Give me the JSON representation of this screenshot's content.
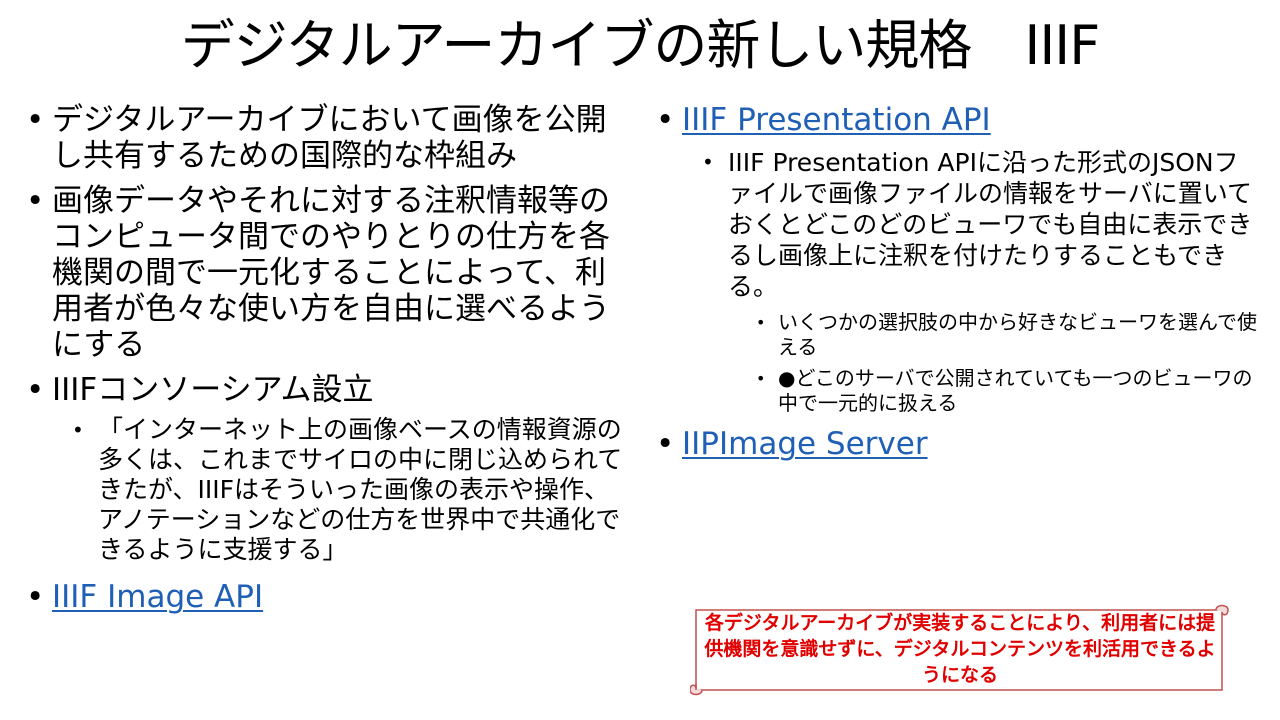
{
  "slide": {
    "title": "デジタルアーカイブの新しい規格　IIIF",
    "left": {
      "item1": "デジタルアーカイブにおいて画像を公開し共有するための国際的な枠組み",
      "item2": "画像データやそれに対する注釈情報等のコンピュータ間でのやりとりの仕方を各機関の間で一元化することによって、利用者が色々な使い方を自由に選べるようにする",
      "item3": "IIIFコンソーシアム設立",
      "item3_sub": "「インターネット上の画像ベースの情報資源の多くは、これまでサイロの中に閉じ込められてきたが、IIIFはそういった画像の表示や操作、アノテーションなどの仕方を世界中で共通化できるように支援する」",
      "item4_link": "IIIF Image API"
    },
    "right": {
      "item1_link": "IIIF Presentation API",
      "item1_sub": "IIIF Presentation APIに沿った形式のJSONファイルで画像ファイルの情報をサーバに置いておくとどこのどのビューワでも自由に表示できるし画像上に注釈を付けたりすることもできる。",
      "item1_sub_a": "いくつかの選択肢の中から好きなビューワを選んで使える",
      "item1_sub_b": "●どこのサーバで公開されていても一つのビューワの中で一元的に扱える",
      "item2_link": "IIPImage Server"
    },
    "callout": "各デジタルアーカイブが実装することにより、利用者には提供機関を意識せずに、デジタルコンテンツを利活用できるようになる",
    "colors": {
      "link": "#1f5fb5",
      "callout_text": "#e00000",
      "callout_border": "#c0504d"
    }
  }
}
